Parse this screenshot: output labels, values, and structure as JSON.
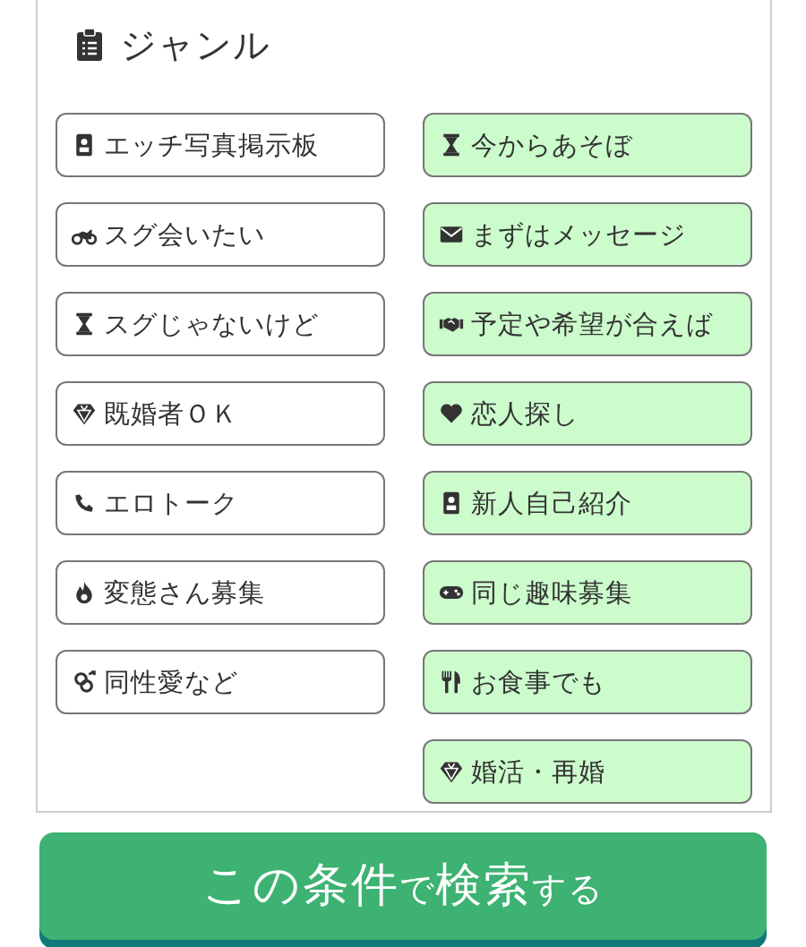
{
  "section": {
    "title": "ジャンル"
  },
  "left_column": [
    {
      "label": "エッチ写真掲示板",
      "selected": false
    },
    {
      "label": "スグ会いたい",
      "selected": false
    },
    {
      "label": "スグじゃないけど",
      "selected": false
    },
    {
      "label": "既婚者ＯＫ",
      "selected": false
    },
    {
      "label": "エロトーク",
      "selected": false
    },
    {
      "label": "変態さん募集",
      "selected": false
    },
    {
      "label": "同性愛など",
      "selected": false
    }
  ],
  "right_column": [
    {
      "label": "今からあそぼ",
      "selected": true
    },
    {
      "label": "まずはメッセージ",
      "selected": true
    },
    {
      "label": "予定や希望が合えば",
      "selected": true
    },
    {
      "label": "恋人探し",
      "selected": true
    },
    {
      "label": "新人自己紹介",
      "selected": true
    },
    {
      "label": "同じ趣味募集",
      "selected": true
    },
    {
      "label": "お食事でも",
      "selected": true
    },
    {
      "label": "婚活・再婚",
      "selected": true
    }
  ],
  "search_button": {
    "parts": [
      {
        "text": "この条件",
        "kind": "large"
      },
      {
        "text": "で",
        "kind": "small"
      },
      {
        "text": "検索",
        "kind": "large"
      },
      {
        "text": "する",
        "kind": "small"
      }
    ]
  }
}
